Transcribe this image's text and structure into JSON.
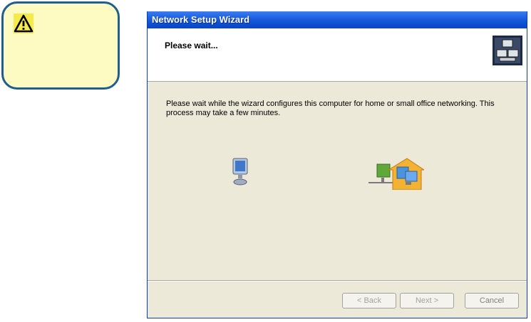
{
  "callout": {
    "icon": "warning-icon"
  },
  "window": {
    "title": "Network Setup Wizard",
    "header": {
      "heading": "Please wait...",
      "icon": "network-wizard-icon"
    },
    "body": {
      "message": "Please wait while the wizard configures this computer for home or small office networking. This process may take a few minutes.",
      "animation_left_icon": "computer-icon",
      "animation_right_icon": "home-network-icon"
    },
    "buttons": {
      "back": "< Back",
      "next": "Next >",
      "cancel": "Cancel"
    }
  },
  "colors": {
    "titlebar": "#0f4fd2",
    "window_bg": "#ece9d8",
    "callout_border": "#1f5f8f",
    "callout_bg": "#fdfbc2"
  }
}
